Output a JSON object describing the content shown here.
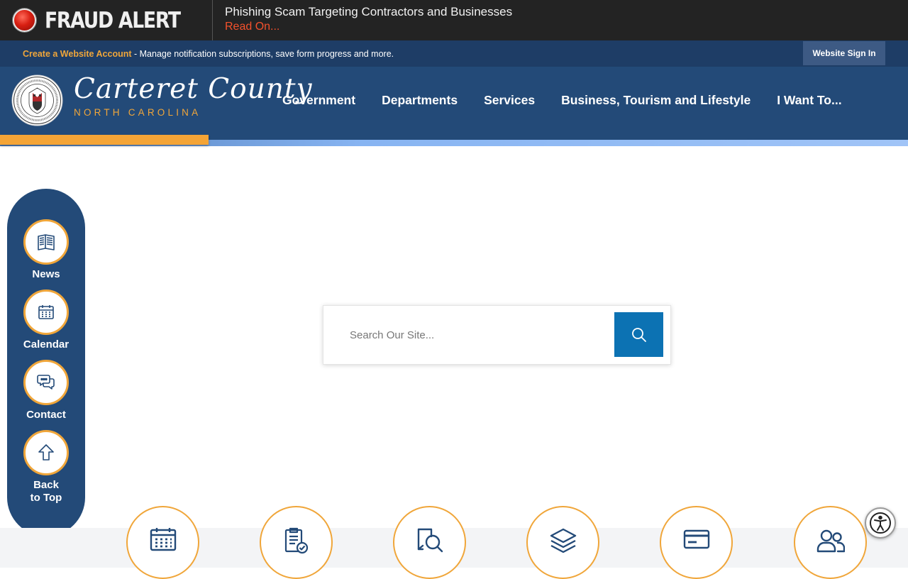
{
  "alert": {
    "title": "FRAUD ALERT",
    "headline": "Phishing Scam Targeting Contractors and Businesses",
    "link_text": "Read On..."
  },
  "account_bar": {
    "create_link": "Create a Website Account",
    "description": " - Manage notification subscriptions, save form progress and more.",
    "signin_label": "Website Sign In"
  },
  "logo": {
    "name": "Carteret County",
    "subtitle": "NORTH CAROLINA"
  },
  "nav": {
    "items": [
      "Government",
      "Departments",
      "Services",
      "Business, Tourism and Lifestyle",
      "I Want To..."
    ]
  },
  "sidebar": {
    "items": [
      {
        "label": "News",
        "icon": "news-icon"
      },
      {
        "label": "Calendar",
        "icon": "calendar-icon"
      },
      {
        "label": "Contact",
        "icon": "chat-icon"
      },
      {
        "label": "Back to Top",
        "icon": "arrow-up-icon"
      }
    ]
  },
  "search": {
    "placeholder": "Search Our Site..."
  },
  "quick_links": {
    "icons": [
      "calendar-icon",
      "checklist-icon",
      "document-search-icon",
      "layers-icon",
      "payment-card-icon",
      "people-icon"
    ]
  },
  "colors": {
    "navy": "#234a78",
    "orange": "#f0a63a",
    "search_blue": "#0c72b3",
    "alert_red": "#f4512c"
  }
}
